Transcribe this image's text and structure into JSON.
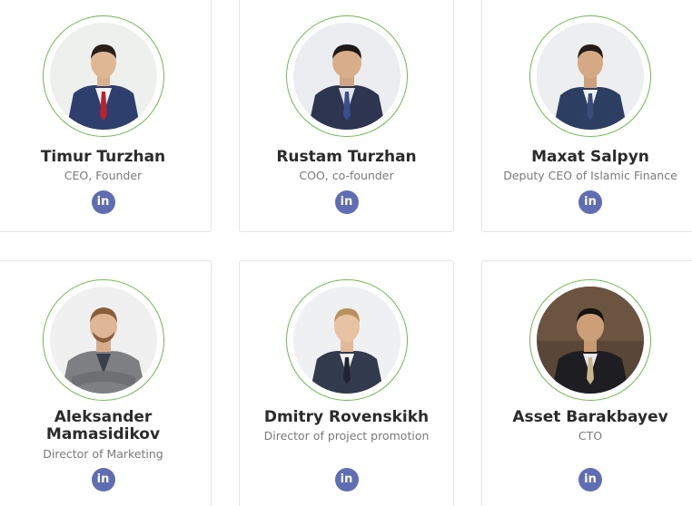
{
  "team": [
    {
      "name": "Timur Turzhan",
      "role": "CEO, Founder",
      "linkedin_icon": "linkedin-icon",
      "linkedin_label": "in"
    },
    {
      "name": "Rustam Turzhan",
      "role": "COO, co-founder",
      "linkedin_icon": "linkedin-icon",
      "linkedin_label": "in"
    },
    {
      "name": "Maxat Salpyn",
      "role": "Deputy CEO of Islamic Finance",
      "linkedin_icon": "linkedin-icon",
      "linkedin_label": "in"
    },
    {
      "name_line1": "Aleksander",
      "name_line2": "Mamasidikov",
      "role": "Director of Marketing",
      "linkedin_icon": "linkedin-icon",
      "linkedin_label": "in"
    },
    {
      "name": "Dmitry Rovenskikh",
      "role": "Director of project promotion",
      "linkedin_icon": "linkedin-icon",
      "linkedin_label": "in"
    },
    {
      "name": "Asset Barakbayev",
      "role": "CTO",
      "linkedin_icon": "linkedin-icon",
      "linkedin_label": "in"
    }
  ],
  "colors": {
    "ring": "#6cbf4a",
    "linkedin": "#5f6db3",
    "name": "#2b2b2b",
    "role": "#7a7a7a"
  }
}
